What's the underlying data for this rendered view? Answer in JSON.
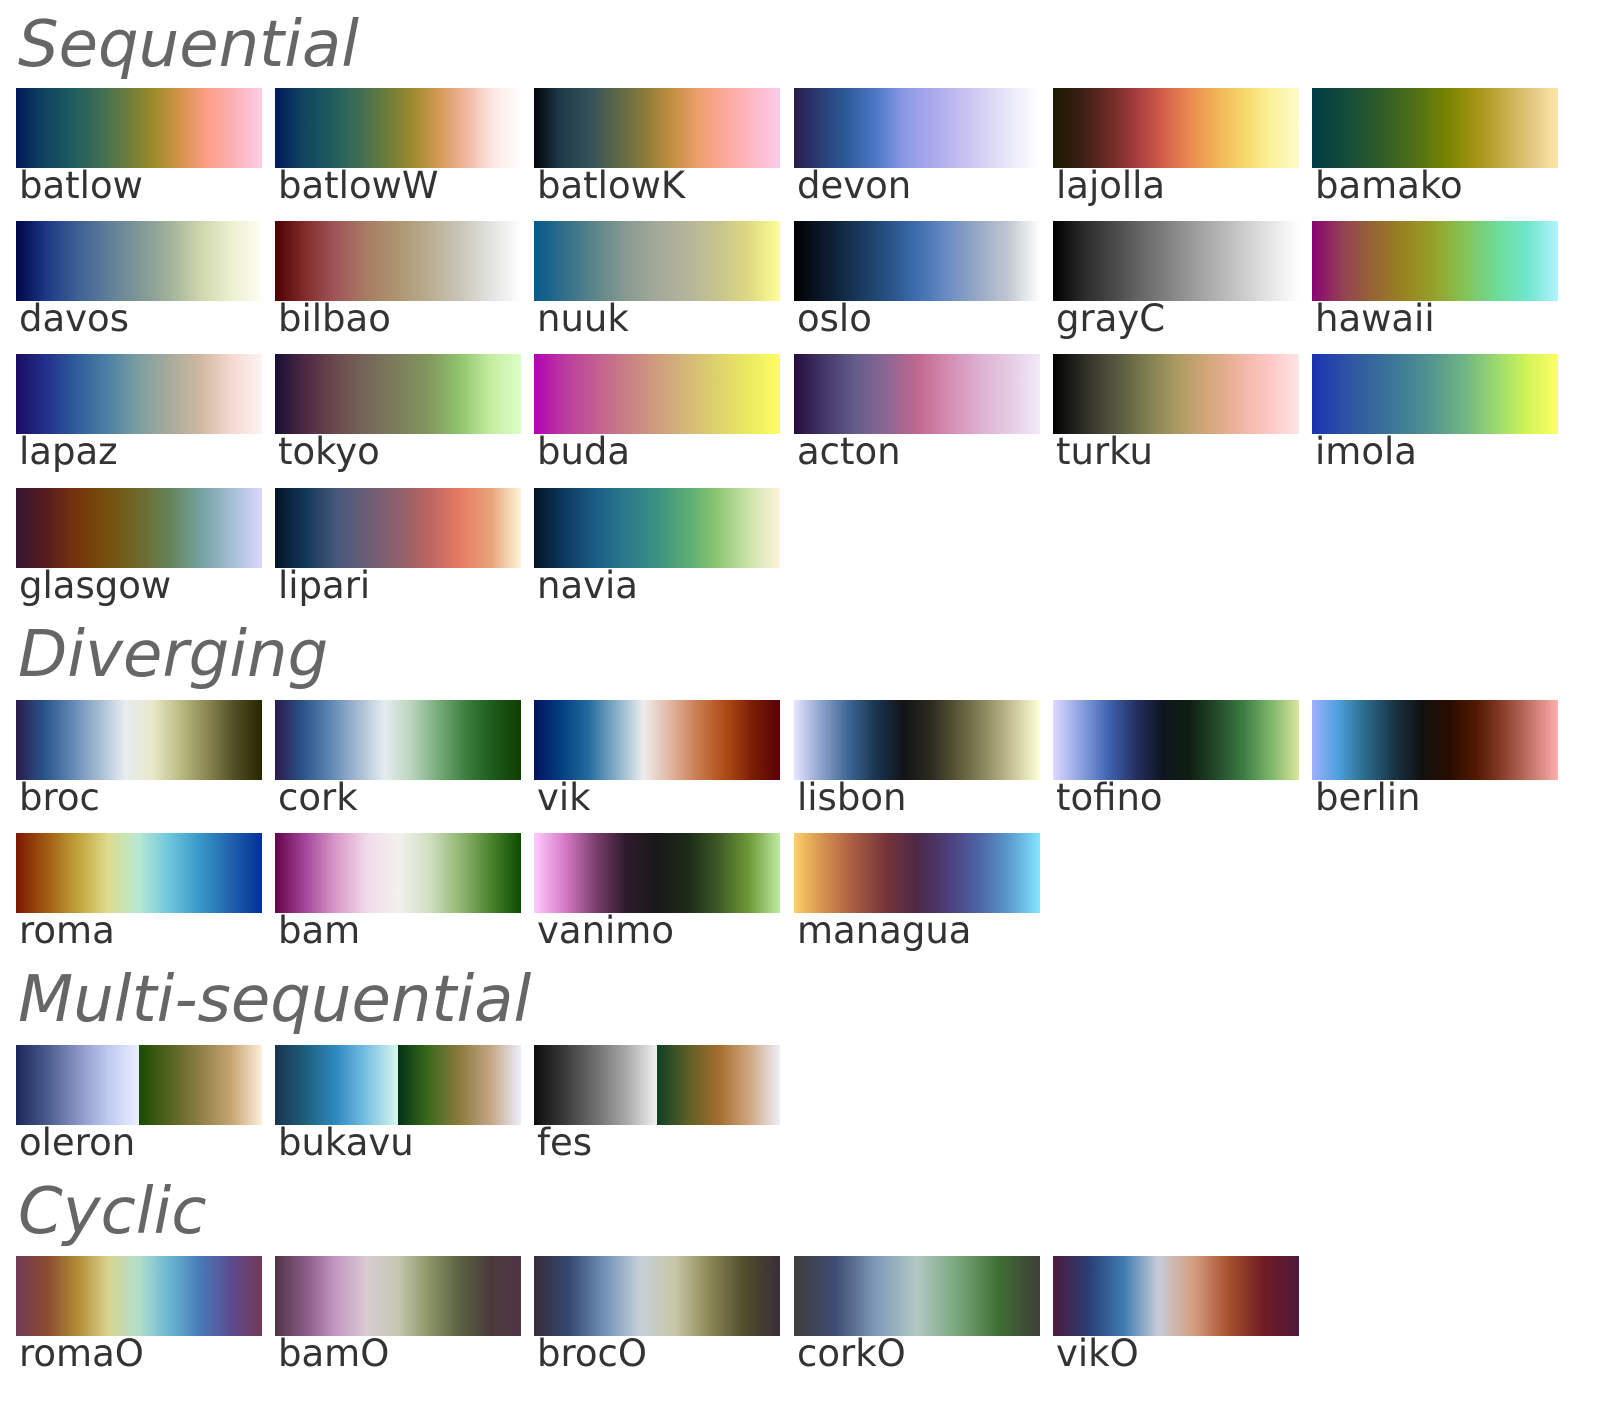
{
  "sections": [
    {
      "title": "Sequential",
      "items": [
        {
          "name": "batlow",
          "colors": [
            "#011959",
            "#0f4360",
            "#1d5b5e",
            "#3c6d56",
            "#687b3e",
            "#9a8a2a",
            "#d49348",
            "#fd9e87",
            "#fbb1b8",
            "#fccde5"
          ]
        },
        {
          "name": "batlowW",
          "colors": [
            "#011959",
            "#0f4360",
            "#1d5b5e",
            "#3c6d56",
            "#687b3e",
            "#9a8a2a",
            "#d49a54",
            "#f2b5a0",
            "#fde8e5",
            "#fffefe"
          ]
        },
        {
          "name": "batlowK",
          "colors": [
            "#04050a",
            "#1f3b49",
            "#33505a",
            "#5b6648",
            "#877a3a",
            "#c08e3f",
            "#ec9f6c",
            "#fca89c",
            "#fdb9c7",
            "#fbcbe9"
          ]
        },
        {
          "name": "devon",
          "colors": [
            "#2c1a4c",
            "#293f75",
            "#2e5d9c",
            "#4d78c8",
            "#8a98e5",
            "#a9a7ec",
            "#c1bdf0",
            "#d6d3f4",
            "#ecebfa",
            "#ffffff"
          ]
        },
        {
          "name": "lajolla",
          "colors": [
            "#1a1a01",
            "#3a1e12",
            "#6a2a25",
            "#a33c3c",
            "#d45d4a",
            "#e88a51",
            "#f1b456",
            "#f7d86a",
            "#fbf19b",
            "#fefbcb"
          ]
        },
        {
          "name": "bamako",
          "colors": [
            "#003b46",
            "#0f4a3c",
            "#235631",
            "#3a6422",
            "#577412",
            "#7b8600",
            "#a39413",
            "#c7ab48",
            "#e2c77e",
            "#ffe5ad"
          ]
        }
      ]
    },
    {
      "title": "",
      "items": [
        {
          "name": "davos",
          "colors": [
            "#00054a",
            "#1c3a86",
            "#3e6094",
            "#5f7e98",
            "#7e9796",
            "#a1b39a",
            "#cdd6ac",
            "#ecf0cf",
            "#fefef5"
          ]
        },
        {
          "name": "bilbao",
          "colors": [
            "#4d0001",
            "#842d2d",
            "#a0575b",
            "#a87d63",
            "#ae9571",
            "#b8ad8f",
            "#c9c5b6",
            "#e2e2e0",
            "#ffffff"
          ]
        },
        {
          "name": "nuuk",
          "colors": [
            "#05598c",
            "#326f8a",
            "#5d8689",
            "#889a92",
            "#a4a99a",
            "#b5b59a",
            "#c7c48e",
            "#dfd981",
            "#fefe99"
          ]
        },
        {
          "name": "oslo",
          "colors": [
            "#010101",
            "#0c1a2c",
            "#163556",
            "#255082",
            "#3e6eb0",
            "#6a8cc4",
            "#98a9c4",
            "#c3c9d1",
            "#ffffff"
          ]
        },
        {
          "name": "grayC",
          "colors": [
            "#000000",
            "#2b2b2b",
            "#4a4a4a",
            "#6b6b6b",
            "#8a8a8a",
            "#a8a8a8",
            "#c6c6c6",
            "#e3e3e3",
            "#ffffff"
          ]
        },
        {
          "name": "hawaii",
          "colors": [
            "#8c0273",
            "#934253",
            "#966535",
            "#988421",
            "#95a329",
            "#84c45a",
            "#6ddb97",
            "#6de7cc",
            "#b3f2fd"
          ]
        }
      ]
    },
    {
      "title": "",
      "items": [
        {
          "name": "lapaz",
          "colors": [
            "#1a0c64",
            "#23318c",
            "#2f5e9c",
            "#4e82a3",
            "#7d9ea1",
            "#a9aa9c",
            "#cfb9a2",
            "#f4d9cf",
            "#fef2f3"
          ]
        },
        {
          "name": "tokyo",
          "colors": [
            "#1a0e34",
            "#4e2a45",
            "#6b4b4e",
            "#76675a",
            "#7c7f5c",
            "#83975d",
            "#8fc46d",
            "#c3ec9f",
            "#daffc7"
          ]
        },
        {
          "name": "buda",
          "colors": [
            "#b201b5",
            "#bc3b9f",
            "#c35e90",
            "#c97e86",
            "#cf9c7e",
            "#d5b877",
            "#ddd36c",
            "#ebe95f",
            "#fffe66"
          ]
        },
        {
          "name": "acton",
          "colors": [
            "#260c3f",
            "#453869",
            "#635d8b",
            "#8c6794",
            "#c0678e",
            "#d58bb0",
            "#dcaed0",
            "#e5cbe4",
            "#f0eaf9"
          ]
        },
        {
          "name": "turku",
          "colors": [
            "#000000",
            "#2e2e27",
            "#555540",
            "#7c7c50",
            "#a99a60",
            "#d2a67a",
            "#eeb39d",
            "#fec6c4",
            "#ffe6e6"
          ]
        },
        {
          "name": "imola",
          "colors": [
            "#1a33b3",
            "#2b4fa4",
            "#36689c",
            "#417f95",
            "#56998c",
            "#71b784",
            "#9ad96f",
            "#d1f458",
            "#feff66"
          ]
        }
      ]
    },
    {
      "title": "",
      "items": [
        {
          "name": "glasgow",
          "colors": [
            "#361733",
            "#581d1f",
            "#77350c",
            "#75510e",
            "#6c6a2c",
            "#65835a",
            "#73a2a0",
            "#a3bdd4",
            "#dbd7ff"
          ]
        },
        {
          "name": "lipari",
          "colors": [
            "#031326",
            "#13385a",
            "#47587a",
            "#6b5f76",
            "#8e616c",
            "#bc6461",
            "#e57b62",
            "#e7a279",
            "#fdf5da"
          ]
        },
        {
          "name": "navia",
          "colors": [
            "#031327",
            "#0d3a62",
            "#1c5d86",
            "#2b7a8c",
            "#3b9281",
            "#5aab73",
            "#8fc772",
            "#cde3aa",
            "#fcf5d9"
          ]
        }
      ]
    },
    {
      "title": "Diverging",
      "items": [
        {
          "name": "broc",
          "colors": [
            "#2c1a4c",
            "#29528a",
            "#5d85b3",
            "#a2bad1",
            "#e7ecef",
            "#e8e8c9",
            "#bdbc84",
            "#8a8752",
            "#504e24",
            "#262600"
          ]
        },
        {
          "name": "cork",
          "colors": [
            "#2c1a4c",
            "#2a5389",
            "#5c85b2",
            "#a3b8d0",
            "#e5ecef",
            "#b9d4bb",
            "#76ab7a",
            "#3b7d3e",
            "#1b5a1a",
            "#0f3f00"
          ]
        },
        {
          "name": "vik",
          "colors": [
            "#001260",
            "#023f80",
            "#246b9f",
            "#85aec7",
            "#ebeded",
            "#e1b5a0",
            "#c87b4f",
            "#af4c15",
            "#7b1d06",
            "#590007"
          ]
        },
        {
          "name": "lisbon",
          "colors": [
            "#e6e5ff",
            "#8ba2cc",
            "#3c6593",
            "#1b3551",
            "#111417",
            "#2c2b1f",
            "#5c5838",
            "#8e8a60",
            "#c8c497",
            "#ffffd9"
          ]
        },
        {
          "name": "tofino",
          "colors": [
            "#ded9ff",
            "#8ea3e3",
            "#4166b1",
            "#253165",
            "#0f1520",
            "#0f1f13",
            "#234a2a",
            "#3e7f45",
            "#7fb86b",
            "#dbe69b"
          ]
        },
        {
          "name": "berlin",
          "colors": [
            "#9eb0ff",
            "#4a9fd8",
            "#2a6887",
            "#193446",
            "#111111",
            "#280d01",
            "#501803",
            "#8a3f2a",
            "#c3756a",
            "#ffadad"
          ]
        }
      ]
    },
    {
      "title": "",
      "items": [
        {
          "name": "roma",
          "colors": [
            "#7e1700",
            "#a05c12",
            "#c1a23a",
            "#dedc8e",
            "#b7e9d4",
            "#6cc5dd",
            "#3897c8",
            "#2161ad",
            "#023198"
          ]
        },
        {
          "name": "bam",
          "colors": [
            "#65024b",
            "#a6479b",
            "#d99ac9",
            "#f1dbea",
            "#f2f1ef",
            "#d1dfc3",
            "#93b874",
            "#4d8430",
            "#0d4c00"
          ]
        },
        {
          "name": "vanimo",
          "colors": [
            "#ffcdfd",
            "#d77ac7",
            "#7b3f6f",
            "#2e1a2c",
            "#191919",
            "#1c2a18",
            "#3e5a26",
            "#6f9a39",
            "#beeda1"
          ]
        },
        {
          "name": "managua",
          "colors": [
            "#ffcf68",
            "#d28d4f",
            "#a65a43",
            "#76343c",
            "#4c2946",
            "#4d3e79",
            "#4d64a4",
            "#5b9bcf",
            "#82e6ff"
          ]
        }
      ]
    },
    {
      "title": "Multi-sequential",
      "items": [
        {
          "name": "oleron",
          "halves": [
            [
              "#1a2659",
              "#4a5a8c",
              "#8893c4",
              "#bfcaf2",
              "#eaf0ff"
            ],
            [
              "#1a4c00",
              "#556320",
              "#8f7f45",
              "#c6a572",
              "#fdeddb"
            ]
          ]
        },
        {
          "name": "bukavu",
          "halves": [
            [
              "#19334c",
              "#1e5f7e",
              "#2f8ac0",
              "#7ac2e4",
              "#d9f8ea"
            ],
            [
              "#003316",
              "#3d6a1c",
              "#8c7a3e",
              "#c2a582",
              "#eeeefc"
            ]
          ]
        },
        {
          "name": "fes",
          "halves": [
            [
              "#0d0d0d",
              "#3a3a3a",
              "#6f6f6f",
              "#a8a8a8",
              "#f1f1f1"
            ],
            [
              "#0e3f26",
              "#5b5f25",
              "#a56d2f",
              "#cfa680",
              "#efeefa"
            ]
          ]
        }
      ]
    },
    {
      "title": "Cyclic",
      "items": [
        {
          "name": "romaO",
          "colors": [
            "#733957",
            "#8a4b31",
            "#b28b34",
            "#d8d38f",
            "#b2dfcc",
            "#68b5d3",
            "#4879b8",
            "#5d4b8e",
            "#733957"
          ]
        },
        {
          "name": "bamO",
          "colors": [
            "#4f3446",
            "#8a5b85",
            "#c499c2",
            "#d8ccd2",
            "#c5c8b0",
            "#8c9566",
            "#5a6242",
            "#4b3b3b",
            "#4f3446"
          ]
        },
        {
          "name": "brocO",
          "colors": [
            "#372e38",
            "#354772",
            "#7191b6",
            "#c5cfd8",
            "#c8c7a9",
            "#8b8754",
            "#504c2d",
            "#372e38"
          ]
        },
        {
          "name": "corkO",
          "colors": [
            "#3f3e3a",
            "#3e4b73",
            "#7f9ab8",
            "#b2c8c3",
            "#78a67c",
            "#3f6e34",
            "#3f3e3a"
          ]
        },
        {
          "name": "vikO",
          "colors": [
            "#4f1a3d",
            "#293e73",
            "#3f7ab0",
            "#c5cdd7",
            "#d59d80",
            "#a6502e",
            "#6f1b25",
            "#4f1a3d"
          ]
        }
      ]
    }
  ]
}
